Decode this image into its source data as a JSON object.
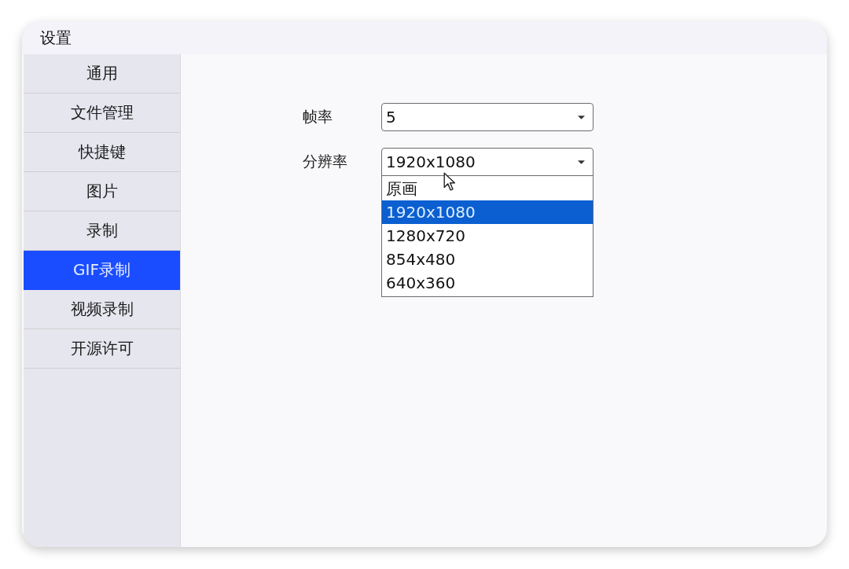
{
  "window": {
    "title": "设置"
  },
  "sidebar": {
    "items": [
      {
        "label": "通用",
        "selected": false
      },
      {
        "label": "文件管理",
        "selected": false
      },
      {
        "label": "快捷键",
        "selected": false
      },
      {
        "label": "图片",
        "selected": false
      },
      {
        "label": "录制",
        "selected": false
      },
      {
        "label": "GIF录制",
        "selected": true
      },
      {
        "label": "视频录制",
        "selected": false
      },
      {
        "label": "开源许可",
        "selected": false
      }
    ]
  },
  "form": {
    "fields": [
      {
        "label": "帧率",
        "value": "5",
        "expanded": false
      },
      {
        "label": "分辨率",
        "value": "1920x1080",
        "expanded": true,
        "options": [
          {
            "label": "原画",
            "selected": false
          },
          {
            "label": "1920x1080",
            "selected": true
          },
          {
            "label": "1280x720",
            "selected": false
          },
          {
            "label": "854x480",
            "selected": false
          },
          {
            "label": "640x360",
            "selected": false
          }
        ]
      }
    ]
  }
}
